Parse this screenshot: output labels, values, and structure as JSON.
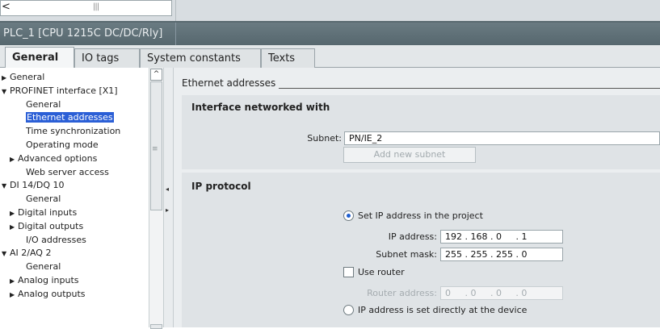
{
  "window": {
    "title": "PLC_1 [CPU 1215C DC/DC/Rly]"
  },
  "tabs": [
    "General",
    "IO tags",
    "System constants",
    "Texts"
  ],
  "nav": {
    "items": [
      {
        "label": "General",
        "indent": 0,
        "arrow": "right"
      },
      {
        "label": "PROFINET interface [X1]",
        "indent": 0,
        "arrow": "down"
      },
      {
        "label": "General",
        "indent": 2,
        "arrow": ""
      },
      {
        "label": "Ethernet addresses",
        "indent": 2,
        "arrow": "",
        "selected": true
      },
      {
        "label": "Time synchronization",
        "indent": 2,
        "arrow": ""
      },
      {
        "label": "Operating mode",
        "indent": 2,
        "arrow": ""
      },
      {
        "label": "Advanced options",
        "indent": 1,
        "arrow": "right"
      },
      {
        "label": "Web server access",
        "indent": 2,
        "arrow": ""
      },
      {
        "label": "DI 14/DQ 10",
        "indent": 0,
        "arrow": "down"
      },
      {
        "label": "General",
        "indent": 2,
        "arrow": ""
      },
      {
        "label": "Digital inputs",
        "indent": 1,
        "arrow": "right"
      },
      {
        "label": "Digital outputs",
        "indent": 1,
        "arrow": "right"
      },
      {
        "label": "I/O addresses",
        "indent": 2,
        "arrow": ""
      },
      {
        "label": "AI 2/AQ 2",
        "indent": 0,
        "arrow": "down"
      },
      {
        "label": "General",
        "indent": 2,
        "arrow": ""
      },
      {
        "label": "Analog inputs",
        "indent": 1,
        "arrow": "right"
      },
      {
        "label": "Analog outputs",
        "indent": 1,
        "arrow": "right"
      }
    ]
  },
  "content": {
    "section_header": "Ethernet addresses",
    "interface": {
      "title": "Interface networked with",
      "subnet_label": "Subnet:",
      "subnet_value": "PN/IE_2",
      "add_subnet_button": "Add new subnet"
    },
    "ip_protocol": {
      "title": "IP protocol",
      "set_in_project_label": "Set IP address in the project",
      "ip_address_label": "IP address:",
      "ip_address_value": "192 . 168 . 0     . 1",
      "subnet_mask_label": "Subnet mask:",
      "subnet_mask_value": "255 . 255 . 255 . 0",
      "use_router_label": "Use router",
      "router_address_label": "Router address:",
      "router_address_value": "0     . 0     . 0     . 0",
      "set_at_device_label": "IP address is set directly at the device",
      "set_in_project_selected": true,
      "use_router_checked": false
    }
  },
  "colors": {
    "title_bar": "#5f7077",
    "selection": "#2b5fd6",
    "radio_dot": "#1f5fd0"
  },
  "icons": {
    "scroll_left": "chevron-left-icon",
    "scroll_up": "chevron-up-icon",
    "expand": "triangle-right-icon",
    "collapse": "triangle-down-icon"
  }
}
